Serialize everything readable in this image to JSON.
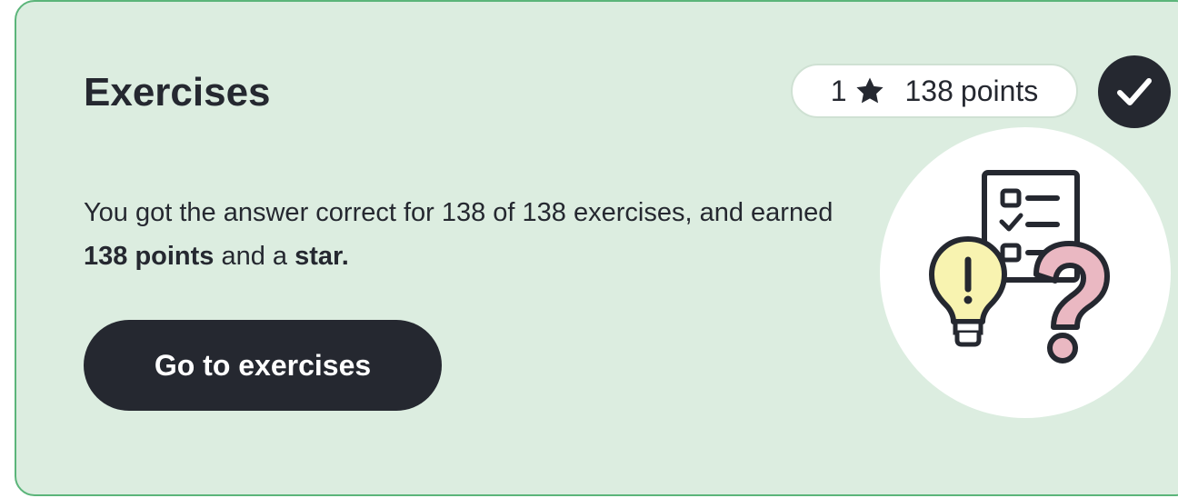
{
  "card": {
    "title": "Exercises",
    "badge": {
      "stars_count": "1",
      "star_icon": "star-icon",
      "points_value": "138",
      "points_label": "points"
    },
    "completed_icon": "checkmark-icon",
    "description": {
      "sentence_start": "You got the answer correct for 138 of 138 exercises, and earned",
      "points_bold": "138 points",
      "middle": " and a ",
      "star_bold": "star."
    },
    "button_label": "Go to exercises",
    "illustration_icon": "exercises-illustration",
    "colors": {
      "card_background": "#dcede0",
      "card_border": "#5bb57a",
      "dark": "#252830",
      "bulb": "#f8f3b0",
      "question_mark": "#eab8c2"
    }
  }
}
